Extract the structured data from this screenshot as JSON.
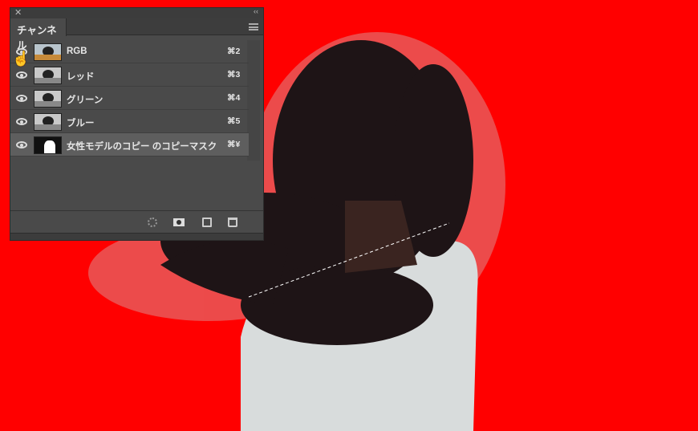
{
  "panel": {
    "close_icon": "close-icon",
    "collapse_icon": "double-chevron-icon",
    "tab_label": "チャンネル",
    "channels": [
      {
        "name": "RGB",
        "shortcut": "⌘2",
        "visible": true,
        "selected": false
      },
      {
        "name": "レッド",
        "shortcut": "⌘3",
        "visible": true,
        "selected": false
      },
      {
        "name": "グリーン",
        "shortcut": "⌘4",
        "visible": true,
        "selected": false
      },
      {
        "name": "ブルー",
        "shortcut": "⌘5",
        "visible": true,
        "selected": false
      },
      {
        "name": "女性モデルのコピー のコピーマスク",
        "shortcut": "⌘¥",
        "visible": true,
        "selected": true
      }
    ]
  },
  "colors": {
    "background": "#ff0000",
    "panel": "#4a4a4a",
    "selected_row": "#5e5e5e"
  }
}
